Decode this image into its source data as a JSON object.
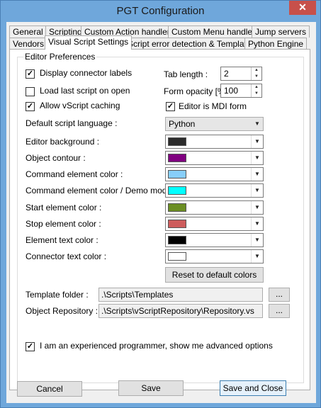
{
  "window": {
    "title": "PGT Configuration",
    "close_glyph": "✕"
  },
  "tabs": {
    "row1": [
      "General",
      "Scripting",
      "Custom Action handlers",
      "Custom Menu handlers",
      "Jump servers"
    ],
    "row2": [
      "Vendors",
      "Visual Script Settings",
      "Script error detection & Templates",
      "Python Engine"
    ],
    "active": "Visual Script Settings"
  },
  "group": {
    "title": "Editor Preferences"
  },
  "options": {
    "display_connector_labels": {
      "label": "Display connector labels",
      "checked": true
    },
    "load_last_script": {
      "label": "Load last script on open",
      "checked": false
    },
    "allow_vscript_caching": {
      "label": "Allow vScript caching",
      "checked": true
    },
    "editor_is_mdi": {
      "label": "Editor is MDI form",
      "checked": true
    },
    "tab_length": {
      "label": "Tab length :",
      "value": "2"
    },
    "form_opacity": {
      "label": "Form opacity [%]:",
      "value": "100"
    },
    "default_script_language": {
      "label": "Default script language :",
      "value": "Python"
    }
  },
  "colors": [
    {
      "label": "Editor background :",
      "color": "#2b2b2b",
      "icon": "color-swatch"
    },
    {
      "label": "Object contour :",
      "color": "#800080",
      "icon": "color-swatch"
    },
    {
      "label": "Command element color :",
      "color": "#87cefa",
      "icon": "color-swatch"
    },
    {
      "label": "Command element color / Demo mode :",
      "color": "#00ffff",
      "icon": "color-swatch"
    },
    {
      "label": "Start element color :",
      "color": "#6b8e23",
      "icon": "color-swatch"
    },
    {
      "label": "Stop element color :",
      "color": "#cd5c5c",
      "icon": "color-swatch"
    },
    {
      "label": "Element text color :",
      "color": "#000000",
      "icon": "color-swatch"
    },
    {
      "label": "Connector text color :",
      "color": "#ffffff",
      "icon": "color-swatch"
    }
  ],
  "reset_button": "Reset to default colors",
  "paths": {
    "template_folder": {
      "label": "Template folder :",
      "value": ".\\Scripts\\Templates",
      "browse": "..."
    },
    "object_repository": {
      "label": "Object Repository :",
      "value": ".\\Scripts\\vScriptRepository\\Repository.vs",
      "browse": "..."
    }
  },
  "advanced": {
    "label": "I am an experienced programmer, show me advanced options",
    "checked": true
  },
  "footer": {
    "cancel": "Cancel",
    "save": "Save",
    "save_close": "Save and Close"
  },
  "watermark": "SOFTPEDIA",
  "theme": {
    "titlebar": "#6fa7db",
    "close": "#c7504a",
    "default_button_border": "#3c7fb1"
  }
}
